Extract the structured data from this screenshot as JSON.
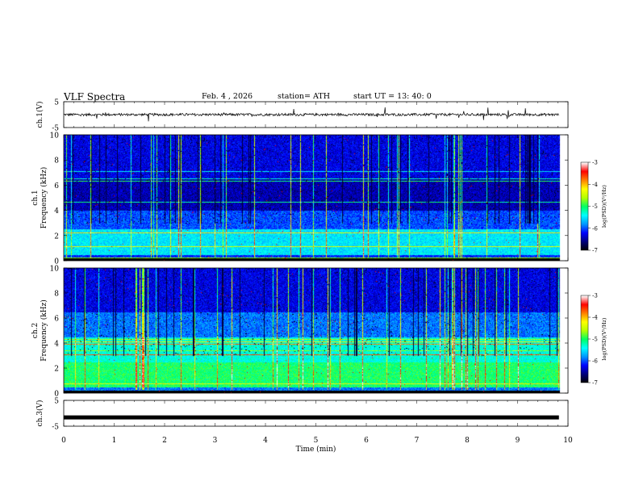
{
  "header": {
    "title": "VLF  Spectra",
    "date": "Feb. 4  , 2026",
    "station": "station= ATH",
    "start_ut": "start  UT  =   13: 40: 0"
  },
  "chart_data": [
    {
      "type": "line",
      "panel": "ch1_waveform",
      "ylabel": "ch.1(V)",
      "ylim": [
        -5,
        5
      ],
      "y_ticks": [
        "5",
        "-5"
      ],
      "xlim": [
        0,
        10
      ],
      "baseline_value": 0,
      "description_values": {
        "typical_amplitude": 0.6,
        "spike_amplitude": 2.5
      }
    },
    {
      "type": "heatmap",
      "panel": "ch1_spectrogram",
      "ylabel": "ch.1\nFrequency  (kHz)",
      "ylabel_lines": [
        "ch.1",
        "Frequency  (kHz)"
      ],
      "ylim": [
        0,
        10
      ],
      "y_ticks": [
        "0",
        "2",
        "4",
        "6",
        "8",
        "10"
      ],
      "xlim": [
        0,
        10
      ],
      "data_end_min": 9.82,
      "colorbar": {
        "label": "log(PSD)(V²/Hz)",
        "range": [
          -7,
          -3
        ],
        "ticks": [
          "-3",
          "-4",
          "-5",
          "-6",
          "-7"
        ]
      }
    },
    {
      "type": "heatmap",
      "panel": "ch2_spectrogram",
      "ylabel": "ch.2\nFrequency  (kHz)",
      "ylabel_lines": [
        "ch.2",
        "Frequency  (kHz)"
      ],
      "ylim": [
        0,
        10
      ],
      "y_ticks": [
        "0",
        "2",
        "4",
        "6",
        "8",
        "10"
      ],
      "xlim": [
        0,
        10
      ],
      "data_end_min": 9.82,
      "colorbar": {
        "label": "log(PSD)(V²/Hz)",
        "range": [
          -7,
          -3
        ],
        "ticks": [
          "-3",
          "-4",
          "-5",
          "-6",
          "-7"
        ]
      }
    },
    {
      "type": "line",
      "panel": "ch3_waveform",
      "ylabel": "ch.3(V)",
      "ylim": [
        -5,
        5
      ],
      "y_ticks": [
        "5",
        "-5"
      ],
      "xlim": [
        0,
        10
      ],
      "baseline_value": -1.6
    }
  ],
  "x_axis": {
    "label": "Time  (min)",
    "ticks": [
      "0",
      "1",
      "2",
      "3",
      "4",
      "5",
      "6",
      "7",
      "8",
      "9",
      "10"
    ]
  },
  "colors": {
    "cmap": [
      "#000000",
      "#00007a",
      "#0000ff",
      "#0096ff",
      "#00ffff",
      "#00ff64",
      "#b4ff00",
      "#ffff00",
      "#ff8000",
      "#ff0000",
      "#ffffff"
    ]
  }
}
